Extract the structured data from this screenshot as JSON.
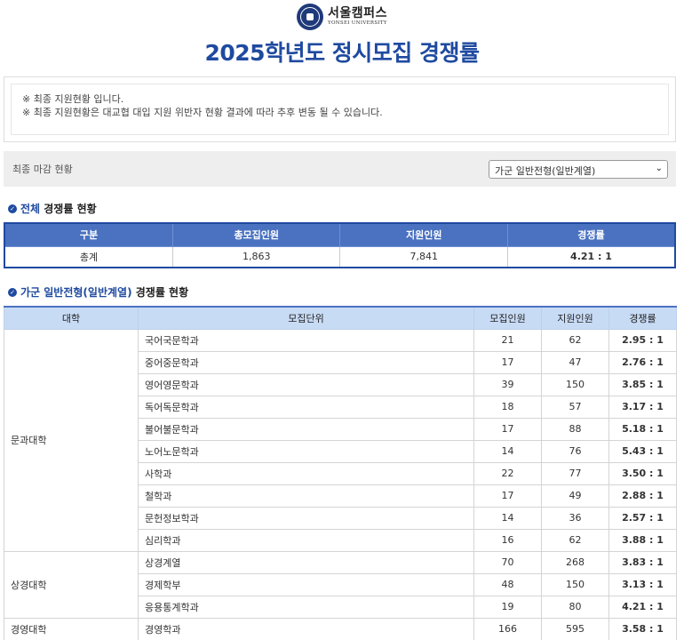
{
  "header": {
    "logo_kr": "서울캠퍼스",
    "logo_en": "YONSEI UNIVERSITY",
    "title": "2025학년도 정시모집 경쟁률"
  },
  "notice": {
    "line1": "※ 최종 지원현황 입니다.",
    "line2": "※ 최종 지원현황은 대교협 대입 지원 위반자 현황 결과에 따라 추후 변동 될 수 있습니다."
  },
  "status": {
    "label": "최종 마감 현황",
    "select_value": "가군 일반전형(일반계열)"
  },
  "overall": {
    "title_hl": "전체",
    "title_rest": " 경쟁률 현황",
    "headers": [
      "구분",
      "총모집인원",
      "지원인원",
      "경쟁률"
    ],
    "row": [
      "총계",
      "1,863",
      "7,841",
      "4.21 : 1"
    ]
  },
  "detail": {
    "title_hl": "가군 일반전형(일반계열)",
    "title_rest": " 경쟁률 현황",
    "headers": [
      "대학",
      "모집단위",
      "모집인원",
      "지원인원",
      "경쟁률"
    ],
    "colleges": [
      {
        "name": "문과대학",
        "rows": [
          [
            "국어국문학과",
            "21",
            "62",
            "2.95 : 1"
          ],
          [
            "중어중문학과",
            "17",
            "47",
            "2.76 : 1"
          ],
          [
            "영어영문학과",
            "39",
            "150",
            "3.85 : 1"
          ],
          [
            "독어독문학과",
            "18",
            "57",
            "3.17 : 1"
          ],
          [
            "불어불문학과",
            "17",
            "88",
            "5.18 : 1"
          ],
          [
            "노어노문학과",
            "14",
            "76",
            "5.43 : 1"
          ],
          [
            "사학과",
            "22",
            "77",
            "3.50 : 1"
          ],
          [
            "철학과",
            "17",
            "49",
            "2.88 : 1"
          ],
          [
            "문헌정보학과",
            "14",
            "36",
            "2.57 : 1"
          ],
          [
            "심리학과",
            "16",
            "62",
            "3.88 : 1"
          ]
        ]
      },
      {
        "name": "상경대학",
        "rows": [
          [
            "상경계열",
            "70",
            "268",
            "3.83 : 1"
          ],
          [
            "경제학부",
            "48",
            "150",
            "3.13 : 1"
          ],
          [
            "응용통계학과",
            "19",
            "80",
            "4.21 : 1"
          ]
        ]
      },
      {
        "name": "경영대학",
        "rows": [
          [
            "경영학과",
            "166",
            "595",
            "3.58 : 1"
          ]
        ]
      }
    ]
  },
  "colors": {
    "primary": "#1f4aa0",
    "header_dark": "#4a72c0",
    "header_light": "#c8dbf5"
  }
}
